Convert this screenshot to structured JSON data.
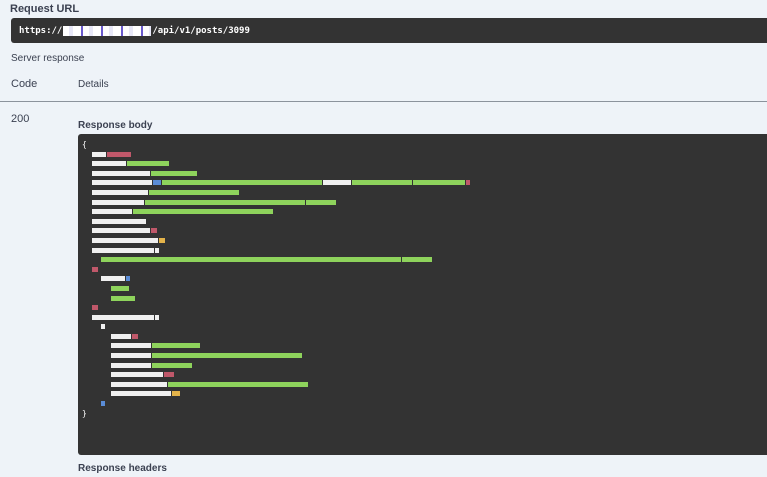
{
  "request": {
    "label": "Request URL",
    "url_prefix": "https://",
    "url_suffix": "/api/v1/posts/3099"
  },
  "server_response": {
    "label": "Server response",
    "col_code": "Code",
    "col_details": "Details",
    "status_code": "200",
    "response_body_label": "Response body",
    "response_body_open": "{",
    "response_body_close": "}",
    "response_headers_label": "Response headers"
  }
}
